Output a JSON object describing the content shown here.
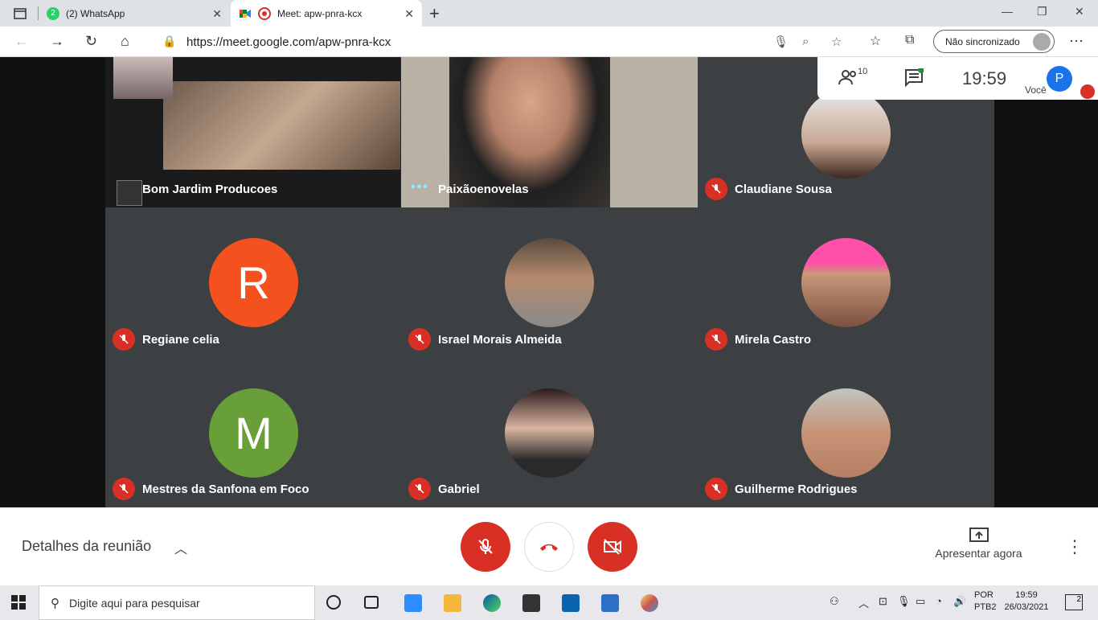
{
  "browser": {
    "tabs": [
      {
        "label": "(2) WhatsApp",
        "badge": "2"
      },
      {
        "label": "Meet: apw-pnra-kcx"
      }
    ],
    "url": "https://meet.google.com/apw-pnra-kcx",
    "sync_label": "Não sincronizado"
  },
  "meet": {
    "participants_count": "10",
    "time": "19:59",
    "self_label": "Você",
    "self_initial": "P",
    "tiles": [
      {
        "name": "Bom Jardim Producoes",
        "kind": "video"
      },
      {
        "name": "Paixãoenovelas",
        "kind": "video"
      },
      {
        "name": "Claudiane Sousa",
        "kind": "photo"
      },
      {
        "name": "Regiane celia",
        "kind": "initial",
        "initial": "R",
        "color": "#f4511e"
      },
      {
        "name": "Israel Morais Almeida",
        "kind": "photo"
      },
      {
        "name": "Mirela Castro",
        "kind": "photo"
      },
      {
        "name": "Mestres da Sanfona em Foco",
        "kind": "initial",
        "initial": "M",
        "color": "#689f38"
      },
      {
        "name": "Gabriel",
        "kind": "photo"
      },
      {
        "name": "Guilherme Rodrigues",
        "kind": "photo"
      }
    ],
    "details_label": "Detalhes da reunião",
    "present_label": "Apresentar agora"
  },
  "taskbar": {
    "search_placeholder": "Digite aqui para pesquisar",
    "lang_1": "POR",
    "lang_2": "PTB2",
    "clock_time": "19:59",
    "clock_date": "26/03/2021",
    "notifications": "2"
  },
  "colors": {
    "red": "#d93025",
    "accent": "#1a73e8"
  }
}
